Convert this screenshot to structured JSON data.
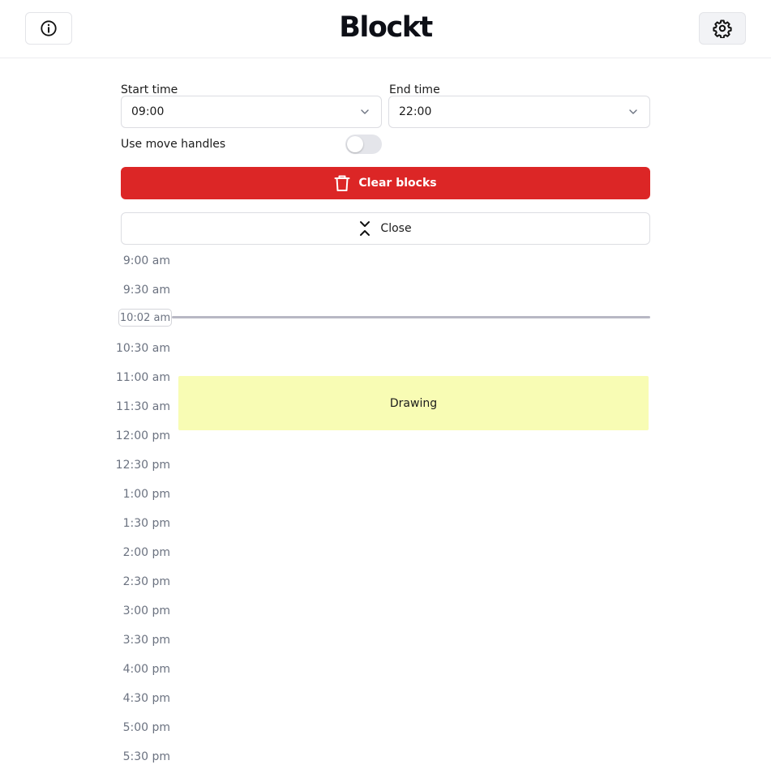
{
  "header": {
    "title": "Blockt",
    "info_icon": "info-icon",
    "settings_icon": "gear-icon"
  },
  "settings": {
    "start_time_label": "Start time",
    "start_time_value": "09:00",
    "end_time_label": "End time",
    "end_time_value": "22:00",
    "move_handles_label": "Use move handles",
    "move_handles_enabled": false,
    "clear_label": "Clear blocks",
    "close_label": "Close"
  },
  "timeline": {
    "slots": [
      "9:00 am",
      "9:30 am",
      "10:30 am",
      "11:00 am",
      "11:30 am",
      "12:00 pm",
      "12:30 pm",
      "1:00 pm",
      "1:30 pm",
      "2:00 pm",
      "2:30 pm",
      "3:00 pm",
      "3:30 pm",
      "4:00 pm",
      "4:30 pm",
      "5:00 pm",
      "5:30 pm"
    ],
    "current_time": "10:02 am",
    "blocks": [
      {
        "label": "Drawing",
        "start": "11:00 am",
        "end": "11:56 am",
        "color": "#f8fcb4"
      }
    ]
  },
  "colors": {
    "danger": "#dc2626",
    "now_line": "#b8b8c4",
    "block": "#f8fcb4"
  }
}
